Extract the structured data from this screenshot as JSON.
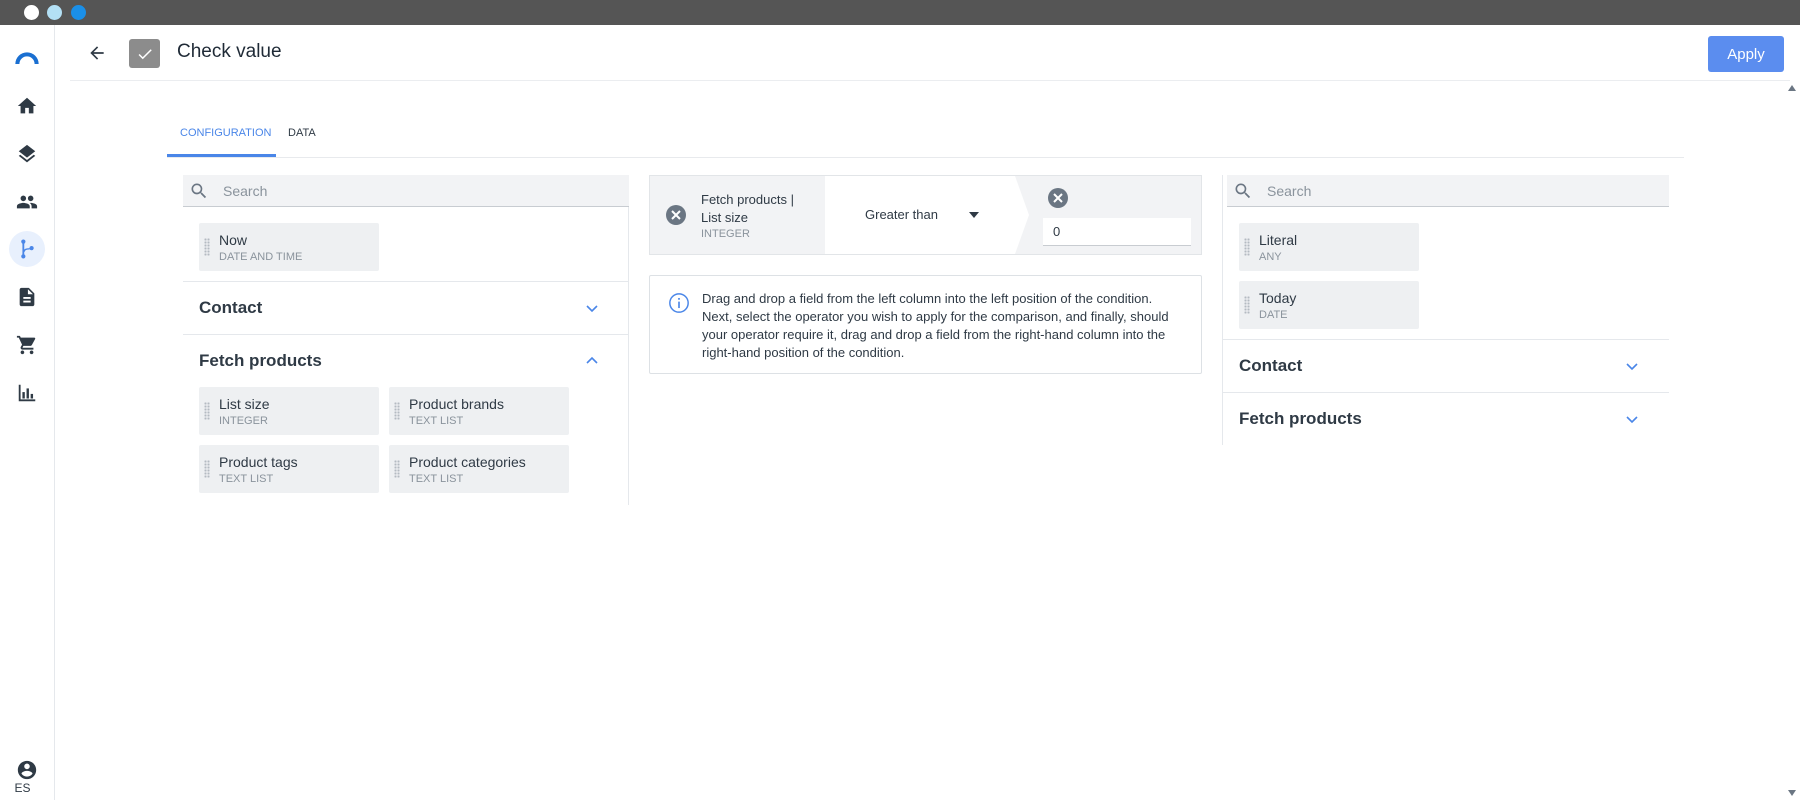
{
  "window": {
    "controls": [
      {
        "name": "close",
        "color": "#ffffff"
      },
      {
        "name": "minimize",
        "color": "#b3e0f5"
      },
      {
        "name": "maximize",
        "color": "#1a8fe8"
      }
    ]
  },
  "sidebar": {
    "items": [
      {
        "icon": "logo-icon"
      },
      {
        "icon": "home-icon"
      },
      {
        "icon": "layers-icon"
      },
      {
        "icon": "people-icon"
      },
      {
        "icon": "flow-icon",
        "active": true
      },
      {
        "icon": "document-icon"
      },
      {
        "icon": "cart-icon"
      },
      {
        "icon": "chart-icon"
      }
    ],
    "account_icon": "account-icon",
    "language": "ES"
  },
  "header": {
    "title": "Check value",
    "apply_label": "Apply"
  },
  "tabs": [
    {
      "label": "CONFIGURATION",
      "active": true
    },
    {
      "label": "DATA",
      "active": false
    }
  ],
  "left_panel": {
    "search_placeholder": "Search",
    "top_fields": [
      {
        "name": "Now",
        "type": "DATE AND TIME"
      }
    ],
    "groups": [
      {
        "title": "Contact",
        "expanded": false,
        "fields": []
      },
      {
        "title": "Fetch products",
        "expanded": true,
        "fields": [
          {
            "name": "List size",
            "type": "INTEGER"
          },
          {
            "name": "Product brands",
            "type": "TEXT LIST"
          },
          {
            "name": "Product tags",
            "type": "TEXT LIST"
          },
          {
            "name": "Product categories",
            "type": "TEXT LIST"
          }
        ]
      }
    ]
  },
  "condition": {
    "left_field": "Fetch products | List size",
    "left_type": "INTEGER",
    "operator": "Greater than",
    "right_value": "0"
  },
  "info": {
    "text": "Drag and drop a field from the left column into the left position of the condition. Next, select the operator you wish to apply for the comparison, and finally, should your operator require it, drag and drop a field from the right-hand column into the right-hand position of the condition."
  },
  "right_panel": {
    "search_placeholder": "Search",
    "top_fields": [
      {
        "name": "Literal",
        "type": "ANY"
      },
      {
        "name": "Today",
        "type": "DATE"
      }
    ],
    "groups": [
      {
        "title": "Contact",
        "expanded": false
      },
      {
        "title": "Fetch products",
        "expanded": false
      }
    ]
  }
}
